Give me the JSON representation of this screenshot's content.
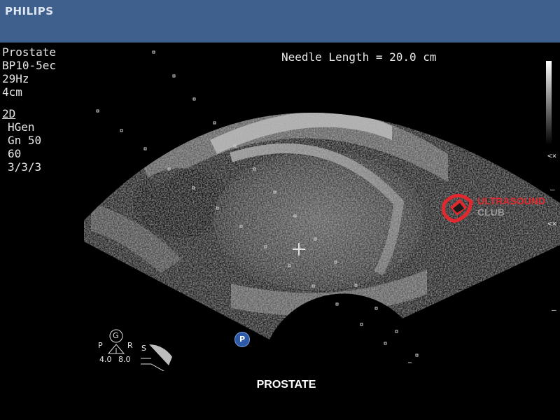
{
  "header": {
    "brand": "PHILIPS",
    "bar_color": "#3f5f8c"
  },
  "params": {
    "exam": "Prostate",
    "probe": "BP10-5ec",
    "frame_rate": "29Hz",
    "depth": "4cm",
    "mode": "2D",
    "gen": "HGen",
    "gain": "Gn 50",
    "dr": "60",
    "persistence": "3/3/3"
  },
  "measurement": {
    "needle_length": "Needle Length = 20.0 cm"
  },
  "markers": {
    "probe_mark": "P"
  },
  "orientation": {
    "guide": "G",
    "left": "P",
    "right": "R",
    "scale1": "4.0",
    "scale2": "8.0",
    "side": "S"
  },
  "watermark": {
    "line1": "ULTRASOUND",
    "line2": "CLUB",
    "color": "#e0282d"
  },
  "caption": "PROSTATE"
}
